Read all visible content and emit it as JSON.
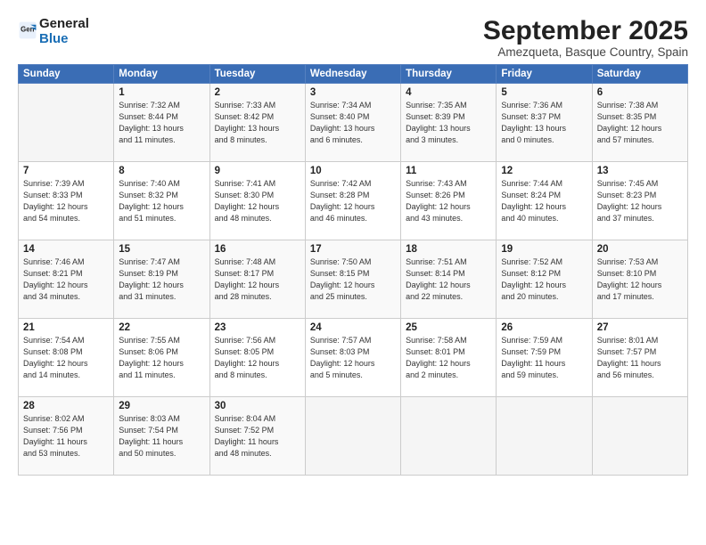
{
  "logo": {
    "general": "General",
    "blue": "Blue"
  },
  "header": {
    "month": "September 2025",
    "location": "Amezqueta, Basque Country, Spain"
  },
  "weekdays": [
    "Sunday",
    "Monday",
    "Tuesday",
    "Wednesday",
    "Thursday",
    "Friday",
    "Saturday"
  ],
  "weeks": [
    [
      {
        "day": "",
        "info": ""
      },
      {
        "day": "1",
        "info": "Sunrise: 7:32 AM\nSunset: 8:44 PM\nDaylight: 13 hours\nand 11 minutes."
      },
      {
        "day": "2",
        "info": "Sunrise: 7:33 AM\nSunset: 8:42 PM\nDaylight: 13 hours\nand 8 minutes."
      },
      {
        "day": "3",
        "info": "Sunrise: 7:34 AM\nSunset: 8:40 PM\nDaylight: 13 hours\nand 6 minutes."
      },
      {
        "day": "4",
        "info": "Sunrise: 7:35 AM\nSunset: 8:39 PM\nDaylight: 13 hours\nand 3 minutes."
      },
      {
        "day": "5",
        "info": "Sunrise: 7:36 AM\nSunset: 8:37 PM\nDaylight: 13 hours\nand 0 minutes."
      },
      {
        "day": "6",
        "info": "Sunrise: 7:38 AM\nSunset: 8:35 PM\nDaylight: 12 hours\nand 57 minutes."
      }
    ],
    [
      {
        "day": "7",
        "info": "Sunrise: 7:39 AM\nSunset: 8:33 PM\nDaylight: 12 hours\nand 54 minutes."
      },
      {
        "day": "8",
        "info": "Sunrise: 7:40 AM\nSunset: 8:32 PM\nDaylight: 12 hours\nand 51 minutes."
      },
      {
        "day": "9",
        "info": "Sunrise: 7:41 AM\nSunset: 8:30 PM\nDaylight: 12 hours\nand 48 minutes."
      },
      {
        "day": "10",
        "info": "Sunrise: 7:42 AM\nSunset: 8:28 PM\nDaylight: 12 hours\nand 46 minutes."
      },
      {
        "day": "11",
        "info": "Sunrise: 7:43 AM\nSunset: 8:26 PM\nDaylight: 12 hours\nand 43 minutes."
      },
      {
        "day": "12",
        "info": "Sunrise: 7:44 AM\nSunset: 8:24 PM\nDaylight: 12 hours\nand 40 minutes."
      },
      {
        "day": "13",
        "info": "Sunrise: 7:45 AM\nSunset: 8:23 PM\nDaylight: 12 hours\nand 37 minutes."
      }
    ],
    [
      {
        "day": "14",
        "info": "Sunrise: 7:46 AM\nSunset: 8:21 PM\nDaylight: 12 hours\nand 34 minutes."
      },
      {
        "day": "15",
        "info": "Sunrise: 7:47 AM\nSunset: 8:19 PM\nDaylight: 12 hours\nand 31 minutes."
      },
      {
        "day": "16",
        "info": "Sunrise: 7:48 AM\nSunset: 8:17 PM\nDaylight: 12 hours\nand 28 minutes."
      },
      {
        "day": "17",
        "info": "Sunrise: 7:50 AM\nSunset: 8:15 PM\nDaylight: 12 hours\nand 25 minutes."
      },
      {
        "day": "18",
        "info": "Sunrise: 7:51 AM\nSunset: 8:14 PM\nDaylight: 12 hours\nand 22 minutes."
      },
      {
        "day": "19",
        "info": "Sunrise: 7:52 AM\nSunset: 8:12 PM\nDaylight: 12 hours\nand 20 minutes."
      },
      {
        "day": "20",
        "info": "Sunrise: 7:53 AM\nSunset: 8:10 PM\nDaylight: 12 hours\nand 17 minutes."
      }
    ],
    [
      {
        "day": "21",
        "info": "Sunrise: 7:54 AM\nSunset: 8:08 PM\nDaylight: 12 hours\nand 14 minutes."
      },
      {
        "day": "22",
        "info": "Sunrise: 7:55 AM\nSunset: 8:06 PM\nDaylight: 12 hours\nand 11 minutes."
      },
      {
        "day": "23",
        "info": "Sunrise: 7:56 AM\nSunset: 8:05 PM\nDaylight: 12 hours\nand 8 minutes."
      },
      {
        "day": "24",
        "info": "Sunrise: 7:57 AM\nSunset: 8:03 PM\nDaylight: 12 hours\nand 5 minutes."
      },
      {
        "day": "25",
        "info": "Sunrise: 7:58 AM\nSunset: 8:01 PM\nDaylight: 12 hours\nand 2 minutes."
      },
      {
        "day": "26",
        "info": "Sunrise: 7:59 AM\nSunset: 7:59 PM\nDaylight: 11 hours\nand 59 minutes."
      },
      {
        "day": "27",
        "info": "Sunrise: 8:01 AM\nSunset: 7:57 PM\nDaylight: 11 hours\nand 56 minutes."
      }
    ],
    [
      {
        "day": "28",
        "info": "Sunrise: 8:02 AM\nSunset: 7:56 PM\nDaylight: 11 hours\nand 53 minutes."
      },
      {
        "day": "29",
        "info": "Sunrise: 8:03 AM\nSunset: 7:54 PM\nDaylight: 11 hours\nand 50 minutes."
      },
      {
        "day": "30",
        "info": "Sunrise: 8:04 AM\nSunset: 7:52 PM\nDaylight: 11 hours\nand 48 minutes."
      },
      {
        "day": "",
        "info": ""
      },
      {
        "day": "",
        "info": ""
      },
      {
        "day": "",
        "info": ""
      },
      {
        "day": "",
        "info": ""
      }
    ]
  ]
}
